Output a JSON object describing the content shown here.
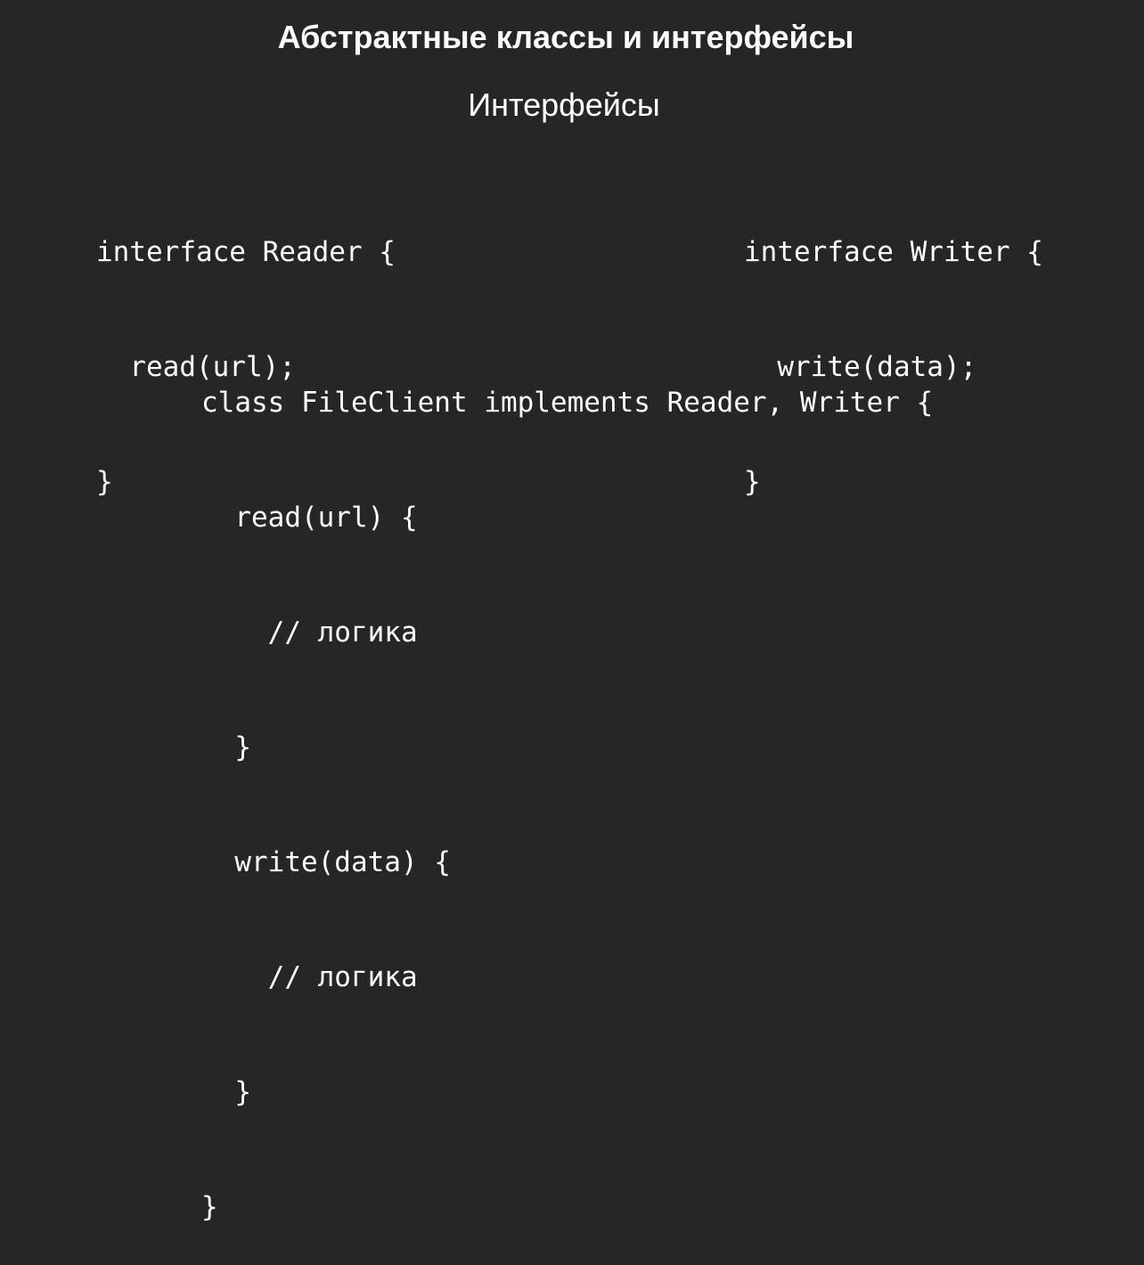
{
  "slide": {
    "title": "Абстрактные классы и интерфейсы",
    "subtitle": "Интерфейсы"
  },
  "code": {
    "reader_interface": [
      "interface Reader {",
      "  read(url);",
      "}"
    ],
    "writer_interface": [
      "interface Writer {",
      "  write(data);",
      "}"
    ],
    "file_client_class": [
      "class FileClient implements Reader, Writer {",
      "  read(url) {",
      "    // логика",
      "  }",
      "  write(data) {",
      "    // логика",
      "  }",
      "}"
    ]
  },
  "colors": {
    "background": "#262629",
    "text": "#ffffff"
  }
}
